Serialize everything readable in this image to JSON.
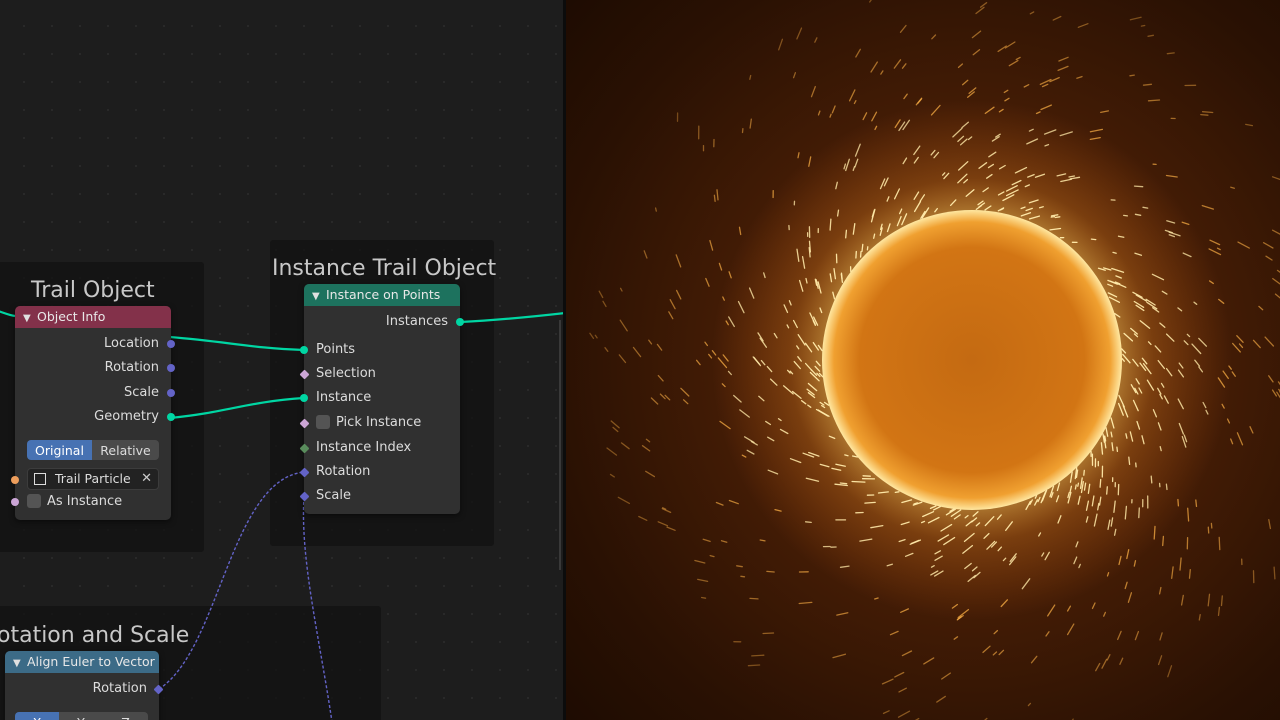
{
  "colors": {
    "geometry_socket": "#00d6a3",
    "vector_socket": "#6363c7",
    "bool_socket": "#cca6d6",
    "int_socket": "#598c5c",
    "object_socket": "#ed9e5c",
    "header_input": "#83314a",
    "header_geometry": "#1d725e",
    "header_vector": "#3c6b87",
    "toggle_active": "#4772b3"
  },
  "frames": {
    "trail_object": "Trail Object",
    "instance_trail_object": "Instance Trail Object",
    "rotation_scale": "otation and Scale"
  },
  "object_info": {
    "title": "Object Info",
    "outputs": [
      "Location",
      "Rotation",
      "Scale",
      "Geometry"
    ],
    "toggle": {
      "original": "Original",
      "relative": "Relative",
      "selected": "Original"
    },
    "object_field": "Trail Particle",
    "as_instance": "As Instance"
  },
  "instance_on_points": {
    "title": "Instance on Points",
    "output": "Instances",
    "inputs": [
      "Points",
      "Selection",
      "Instance",
      "Pick Instance",
      "Instance Index",
      "Rotation",
      "Scale"
    ]
  },
  "align_euler": {
    "title": "Align Euler to Vector",
    "output": "Rotation",
    "axis_options": [
      "X",
      "Y",
      "Z"
    ],
    "selected_axis": "X"
  },
  "viewport": {
    "description_icon": "sparks-render-icon"
  }
}
